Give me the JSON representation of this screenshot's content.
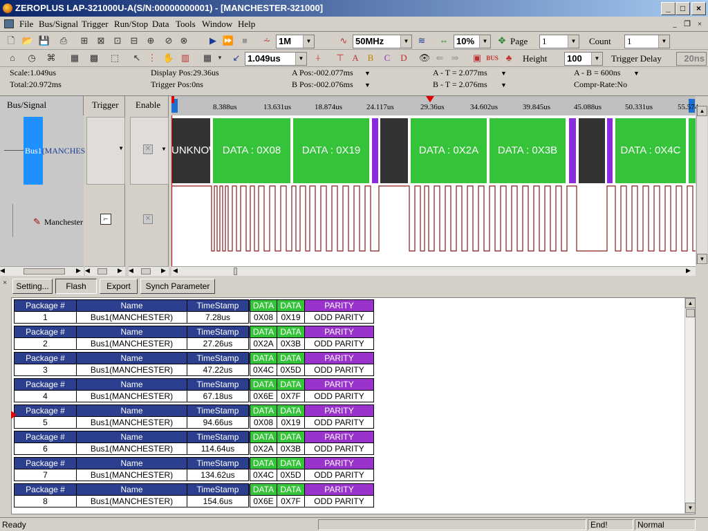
{
  "window": {
    "title": "ZEROPLUS LAP-321000U-A(S/N:00000000001) - [MANCHESTER-321000]",
    "minimize": "_",
    "maximize": "□",
    "close": "×"
  },
  "menu": [
    "File",
    "Bus/Signal",
    "Trigger",
    "Run/Stop",
    "Data",
    "Tools",
    "Window",
    "Help"
  ],
  "toolbar1": {
    "memory": "1M",
    "frequency": "50MHz",
    "zoom": "10%",
    "page_label": "Page",
    "page": "1",
    "count_label": "Count",
    "count": "1"
  },
  "toolbar2": {
    "scale_value": "1.049us",
    "height_label": "Height",
    "height": "100",
    "trigger_delay_label": "Trigger Delay",
    "trigger_delay": "20ns"
  },
  "info": {
    "scale": "Scale:1.049us",
    "total": "Total:20.972ms",
    "display_pos": "Display Pos:29.36us",
    "trigger_pos": "Trigger Pos:0ns",
    "a_pos": "A Pos:-002.077ms",
    "b_pos": "B Pos:-002.076ms",
    "a_t": "A - T = 2.077ms",
    "b_t": "B - T = 2.076ms",
    "a_b": "A - B = 600ns",
    "compr": "Compr-Rate:No"
  },
  "panel": {
    "headers": {
      "bus_signal": "Bus/Signal",
      "trigger": "Trigger",
      "enable": "Enable"
    },
    "bus_label": "Bus1",
    "bus_sub": "(MANCHES",
    "signal_label": "Manchester"
  },
  "ruler": [
    "8.388us",
    "13.631us",
    "18.874us",
    "24.117us",
    "29.36us",
    "34.602us",
    "39.845us",
    "45.088us",
    "50.331us",
    "55.574"
  ],
  "bus_segments": [
    "UNKNOW",
    "DATA : 0X08",
    "DATA : 0X19",
    "DATA : 0X2A",
    "DATA : 0X3B",
    "DATA : 0X4C"
  ],
  "buttons": {
    "setting": "Setting...",
    "flash": "Flash",
    "export": "Export",
    "synch": "Synch Parameter"
  },
  "table": {
    "headers": {
      "package": "Package #",
      "name": "Name",
      "timestamp": "TimeStamp",
      "data1": "DATA",
      "data2": "DATA",
      "parity": "PARITY"
    },
    "rows": [
      {
        "package": "1",
        "name": "Bus1(MANCHESTER)",
        "timestamp": "7.28us",
        "data1": "0X08",
        "data2": "0X19",
        "parity": "ODD PARITY"
      },
      {
        "package": "2",
        "name": "Bus1(MANCHESTER)",
        "timestamp": "27.26us",
        "data1": "0X2A",
        "data2": "0X3B",
        "parity": "ODD PARITY"
      },
      {
        "package": "3",
        "name": "Bus1(MANCHESTER)",
        "timestamp": "47.22us",
        "data1": "0X4C",
        "data2": "0X5D",
        "parity": "ODD PARITY"
      },
      {
        "package": "4",
        "name": "Bus1(MANCHESTER)",
        "timestamp": "67.18us",
        "data1": "0X6E",
        "data2": "0X7F",
        "parity": "ODD PARITY"
      },
      {
        "package": "5",
        "name": "Bus1(MANCHESTER)",
        "timestamp": "94.66us",
        "data1": "0X08",
        "data2": "0X19",
        "parity": "ODD PARITY"
      },
      {
        "package": "6",
        "name": "Bus1(MANCHESTER)",
        "timestamp": "114.64us",
        "data1": "0X2A",
        "data2": "0X3B",
        "parity": "ODD PARITY"
      },
      {
        "package": "7",
        "name": "Bus1(MANCHESTER)",
        "timestamp": "134.62us",
        "data1": "0X4C",
        "data2": "0X5D",
        "parity": "ODD PARITY"
      },
      {
        "package": "8",
        "name": "Bus1(MANCHESTER)",
        "timestamp": "154.6us",
        "data1": "0X6E",
        "data2": "0X7F",
        "parity": "ODD PARITY"
      }
    ]
  },
  "status": {
    "ready": "Ready",
    "end": "End!",
    "mode": "Normal"
  },
  "colors": {
    "title_start": "#0a246a",
    "bus_data": "#35c33a",
    "bus_unknown": "#333333",
    "bus_gap": "#8a2be2",
    "header_blue": "#2b3f8e",
    "parity_purple": "#9933cc",
    "signal": "#8b1a1a",
    "cursor": "#e00000"
  }
}
